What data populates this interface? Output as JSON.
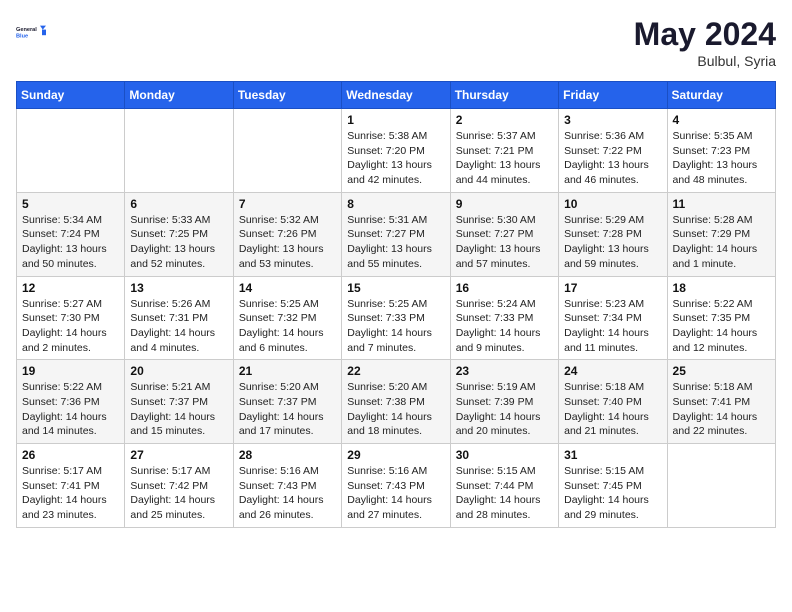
{
  "header": {
    "logo_general": "General",
    "logo_blue": "Blue",
    "month_title": "May 2024",
    "location": "Bulbul, Syria"
  },
  "days_of_week": [
    "Sunday",
    "Monday",
    "Tuesday",
    "Wednesday",
    "Thursday",
    "Friday",
    "Saturday"
  ],
  "weeks": [
    [
      {
        "day": "",
        "sunrise": "",
        "sunset": "",
        "daylight": ""
      },
      {
        "day": "",
        "sunrise": "",
        "sunset": "",
        "daylight": ""
      },
      {
        "day": "",
        "sunrise": "",
        "sunset": "",
        "daylight": ""
      },
      {
        "day": "1",
        "sunrise": "Sunrise: 5:38 AM",
        "sunset": "Sunset: 7:20 PM",
        "daylight": "Daylight: 13 hours and 42 minutes."
      },
      {
        "day": "2",
        "sunrise": "Sunrise: 5:37 AM",
        "sunset": "Sunset: 7:21 PM",
        "daylight": "Daylight: 13 hours and 44 minutes."
      },
      {
        "day": "3",
        "sunrise": "Sunrise: 5:36 AM",
        "sunset": "Sunset: 7:22 PM",
        "daylight": "Daylight: 13 hours and 46 minutes."
      },
      {
        "day": "4",
        "sunrise": "Sunrise: 5:35 AM",
        "sunset": "Sunset: 7:23 PM",
        "daylight": "Daylight: 13 hours and 48 minutes."
      }
    ],
    [
      {
        "day": "5",
        "sunrise": "Sunrise: 5:34 AM",
        "sunset": "Sunset: 7:24 PM",
        "daylight": "Daylight: 13 hours and 50 minutes."
      },
      {
        "day": "6",
        "sunrise": "Sunrise: 5:33 AM",
        "sunset": "Sunset: 7:25 PM",
        "daylight": "Daylight: 13 hours and 52 minutes."
      },
      {
        "day": "7",
        "sunrise": "Sunrise: 5:32 AM",
        "sunset": "Sunset: 7:26 PM",
        "daylight": "Daylight: 13 hours and 53 minutes."
      },
      {
        "day": "8",
        "sunrise": "Sunrise: 5:31 AM",
        "sunset": "Sunset: 7:27 PM",
        "daylight": "Daylight: 13 hours and 55 minutes."
      },
      {
        "day": "9",
        "sunrise": "Sunrise: 5:30 AM",
        "sunset": "Sunset: 7:27 PM",
        "daylight": "Daylight: 13 hours and 57 minutes."
      },
      {
        "day": "10",
        "sunrise": "Sunrise: 5:29 AM",
        "sunset": "Sunset: 7:28 PM",
        "daylight": "Daylight: 13 hours and 59 minutes."
      },
      {
        "day": "11",
        "sunrise": "Sunrise: 5:28 AM",
        "sunset": "Sunset: 7:29 PM",
        "daylight": "Daylight: 14 hours and 1 minute."
      }
    ],
    [
      {
        "day": "12",
        "sunrise": "Sunrise: 5:27 AM",
        "sunset": "Sunset: 7:30 PM",
        "daylight": "Daylight: 14 hours and 2 minutes."
      },
      {
        "day": "13",
        "sunrise": "Sunrise: 5:26 AM",
        "sunset": "Sunset: 7:31 PM",
        "daylight": "Daylight: 14 hours and 4 minutes."
      },
      {
        "day": "14",
        "sunrise": "Sunrise: 5:25 AM",
        "sunset": "Sunset: 7:32 PM",
        "daylight": "Daylight: 14 hours and 6 minutes."
      },
      {
        "day": "15",
        "sunrise": "Sunrise: 5:25 AM",
        "sunset": "Sunset: 7:33 PM",
        "daylight": "Daylight: 14 hours and 7 minutes."
      },
      {
        "day": "16",
        "sunrise": "Sunrise: 5:24 AM",
        "sunset": "Sunset: 7:33 PM",
        "daylight": "Daylight: 14 hours and 9 minutes."
      },
      {
        "day": "17",
        "sunrise": "Sunrise: 5:23 AM",
        "sunset": "Sunset: 7:34 PM",
        "daylight": "Daylight: 14 hours and 11 minutes."
      },
      {
        "day": "18",
        "sunrise": "Sunrise: 5:22 AM",
        "sunset": "Sunset: 7:35 PM",
        "daylight": "Daylight: 14 hours and 12 minutes."
      }
    ],
    [
      {
        "day": "19",
        "sunrise": "Sunrise: 5:22 AM",
        "sunset": "Sunset: 7:36 PM",
        "daylight": "Daylight: 14 hours and 14 minutes."
      },
      {
        "day": "20",
        "sunrise": "Sunrise: 5:21 AM",
        "sunset": "Sunset: 7:37 PM",
        "daylight": "Daylight: 14 hours and 15 minutes."
      },
      {
        "day": "21",
        "sunrise": "Sunrise: 5:20 AM",
        "sunset": "Sunset: 7:37 PM",
        "daylight": "Daylight: 14 hours and 17 minutes."
      },
      {
        "day": "22",
        "sunrise": "Sunrise: 5:20 AM",
        "sunset": "Sunset: 7:38 PM",
        "daylight": "Daylight: 14 hours and 18 minutes."
      },
      {
        "day": "23",
        "sunrise": "Sunrise: 5:19 AM",
        "sunset": "Sunset: 7:39 PM",
        "daylight": "Daylight: 14 hours and 20 minutes."
      },
      {
        "day": "24",
        "sunrise": "Sunrise: 5:18 AM",
        "sunset": "Sunset: 7:40 PM",
        "daylight": "Daylight: 14 hours and 21 minutes."
      },
      {
        "day": "25",
        "sunrise": "Sunrise: 5:18 AM",
        "sunset": "Sunset: 7:41 PM",
        "daylight": "Daylight: 14 hours and 22 minutes."
      }
    ],
    [
      {
        "day": "26",
        "sunrise": "Sunrise: 5:17 AM",
        "sunset": "Sunset: 7:41 PM",
        "daylight": "Daylight: 14 hours and 23 minutes."
      },
      {
        "day": "27",
        "sunrise": "Sunrise: 5:17 AM",
        "sunset": "Sunset: 7:42 PM",
        "daylight": "Daylight: 14 hours and 25 minutes."
      },
      {
        "day": "28",
        "sunrise": "Sunrise: 5:16 AM",
        "sunset": "Sunset: 7:43 PM",
        "daylight": "Daylight: 14 hours and 26 minutes."
      },
      {
        "day": "29",
        "sunrise": "Sunrise: 5:16 AM",
        "sunset": "Sunset: 7:43 PM",
        "daylight": "Daylight: 14 hours and 27 minutes."
      },
      {
        "day": "30",
        "sunrise": "Sunrise: 5:15 AM",
        "sunset": "Sunset: 7:44 PM",
        "daylight": "Daylight: 14 hours and 28 minutes."
      },
      {
        "day": "31",
        "sunrise": "Sunrise: 5:15 AM",
        "sunset": "Sunset: 7:45 PM",
        "daylight": "Daylight: 14 hours and 29 minutes."
      },
      {
        "day": "",
        "sunrise": "",
        "sunset": "",
        "daylight": ""
      }
    ]
  ]
}
